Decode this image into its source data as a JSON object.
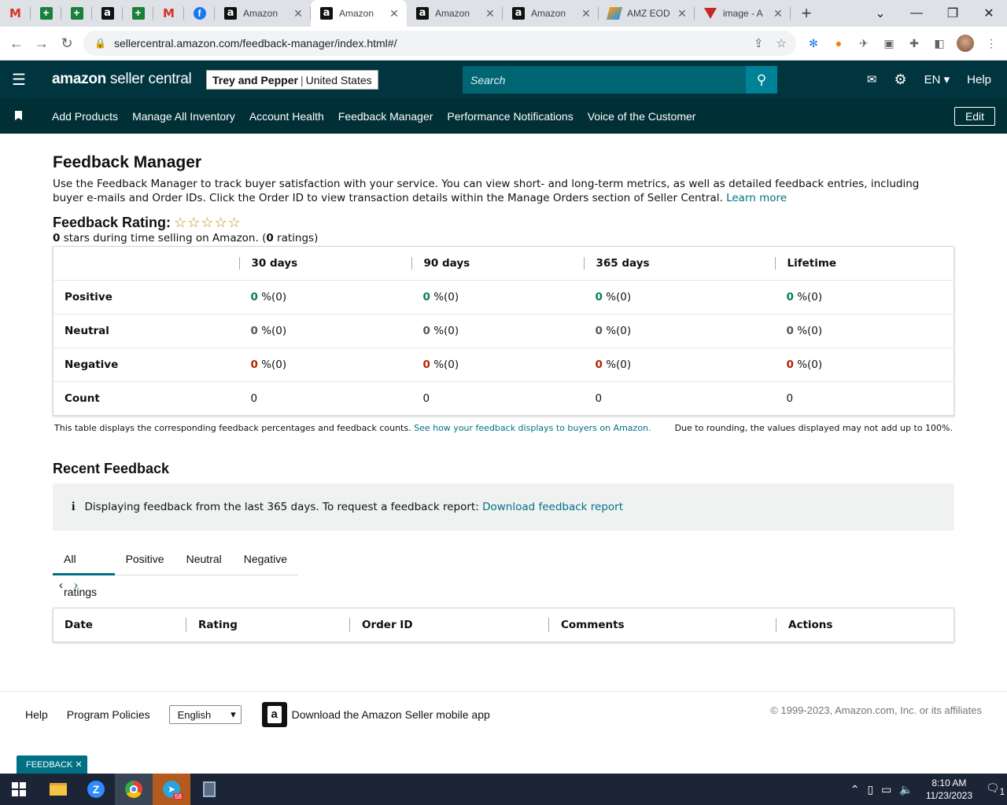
{
  "browser": {
    "tabs": [
      {
        "title": "Amazon",
        "active": false
      },
      {
        "title": "Amazon",
        "active": true
      },
      {
        "title": "Amazon",
        "active": false
      },
      {
        "title": "Amazon",
        "active": false
      },
      {
        "title": "AMZ EOD",
        "active": false
      },
      {
        "title": "image - A",
        "active": false
      }
    ],
    "url": "sellercentral.amazon.com/feedback-manager/index.html#/"
  },
  "header": {
    "logo_bold": "amazon",
    "logo_rest": " seller central",
    "account_name": "Trey and Pepper",
    "account_region": "United States",
    "search_placeholder": "Search",
    "language": "EN",
    "help": "Help"
  },
  "nav": {
    "items": [
      "Add Products",
      "Manage All Inventory",
      "Account Health",
      "Feedback Manager",
      "Performance Notifications",
      "Voice of the Customer"
    ],
    "edit": "Edit"
  },
  "page": {
    "title": "Feedback Manager",
    "description": "Use the Feedback Manager to track buyer satisfaction with your service. You can view short- and long-term metrics, as well as detailed feedback entries, including buyer e-mails and Order IDs. Click the Order ID to view transaction details within the Manage Orders section of Seller Central.",
    "learn_more": "Learn more",
    "rating_label": "Feedback Rating:",
    "stars": "☆☆☆☆☆",
    "stars_count": "0",
    "stars_text": "stars during time selling on Amazon. (",
    "ratings_count": "0",
    "ratings_text": "ratings)"
  },
  "table": {
    "columns": [
      "30 days",
      "90 days",
      "365 days",
      "Lifetime"
    ],
    "rows": [
      {
        "label": "Positive",
        "values": [
          "0",
          "0",
          "0",
          "0"
        ],
        "suffix": "%(0)",
        "color": "#067d62"
      },
      {
        "label": "Neutral",
        "values": [
          "0",
          "0",
          "0",
          "0"
        ],
        "suffix": "%(0)",
        "color": "#565959"
      },
      {
        "label": "Negative",
        "values": [
          "0",
          "0",
          "0",
          "0"
        ],
        "suffix": "%(0)",
        "color": "#b12704"
      },
      {
        "label": "Count",
        "values": [
          "0",
          "0",
          "0",
          "0"
        ]
      }
    ],
    "note_left": "This table displays the corresponding feedback percentages and feedback counts.",
    "note_link": "See how your feedback displays to buyers on Amazon.",
    "note_right": "Due to rounding, the values displayed may not add up to 100%."
  },
  "recent": {
    "title": "Recent Feedback",
    "info_text": "Displaying feedback from the last 365 days. To request a feedback report:",
    "info_link": "Download feedback report",
    "tabs": [
      "All ratings",
      "Positive",
      "Neutral",
      "Negative"
    ],
    "columns": [
      "Date",
      "Rating",
      "Order ID",
      "Comments",
      "Actions"
    ]
  },
  "footer": {
    "help": "Help",
    "policies": "Program Policies",
    "language": "English",
    "app_text": "Download the Amazon Seller mobile app",
    "copyright": "© 1999-2023, Amazon.com, Inc. or its affiliates",
    "feedback_btn": "FEEDBACK ✕"
  },
  "taskbar": {
    "telegram_badge": "58",
    "time": "8:10 AM",
    "date": "11/23/2023",
    "notifications": "1"
  }
}
